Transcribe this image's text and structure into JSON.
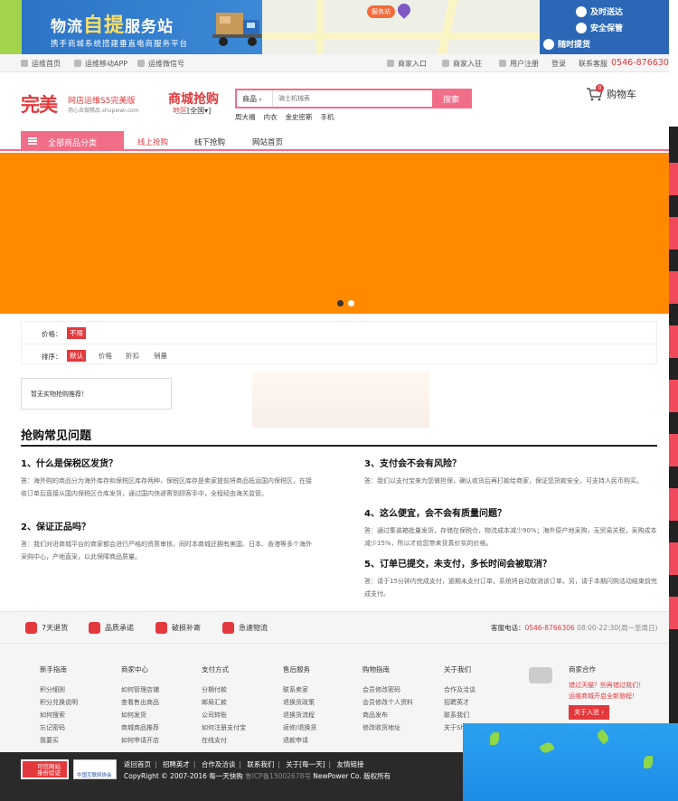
{
  "top_banner": {
    "title_part1": "物流",
    "title_big": "自提",
    "title_part2": "服务站",
    "subtitle": "携手商城系统搭建垂直电商服务平台",
    "map_pin_label": "服务站",
    "features": [
      "及时送达",
      "安全保管",
      "随时提货"
    ]
  },
  "site_nav": {
    "links": [
      "运维首页",
      "运维移动APP",
      "运维微信号",
      "商家入口",
      "商家入驻",
      "用户注册",
      "登录",
      "联系客服"
    ],
    "phone": "0546-8766306"
  },
  "header": {
    "logo": "完美",
    "logo_sub1": "网店运维S5完美版",
    "logo_sub2": "用心去做精品 shopwwi.com",
    "mall_title": "商城抢购",
    "region_label": "地区",
    "region_value": "[全国▾]",
    "search_category": "商品",
    "search_placeholder": "骑士机械表",
    "search_button": "搜索",
    "hot_words": [
      "周大福",
      "内衣",
      "金史密斯",
      "手机"
    ],
    "cart_label": "购物车",
    "cart_count": "0"
  },
  "main_nav": {
    "all_categories": "全部商品分类",
    "links": [
      "线上抢购",
      "线下抢购",
      "网站首页"
    ]
  },
  "filter": {
    "price_label": "价格：",
    "price_options": [
      "不限"
    ],
    "sort_label": "排序：",
    "sort_options": [
      "默认",
      "价格",
      "折扣",
      "销量"
    ]
  },
  "empty_message": "暂无实物抢购推荐！",
  "faq": {
    "title": "抢购常见问题",
    "items": [
      {
        "q": "1、什么是保税区发货？",
        "a": "答：海外购的商品分为海外库存和保税区库存两种，保税区库存是卖家提前将商品抵运国内保税区，在接收订单后直接从国内保税区仓库发货，通过国内快递寄到顾客手中，全程经由海关监管。"
      },
      {
        "q": "2、保证正品吗？",
        "a": "答：我们对进商城平台的商家都会进行严格的资质审核，同时本商城还拥有美国、日本、香港等多个海外采购中心，产地直采，以此保障商品质量。"
      },
      {
        "q": "3、支付会不会有风险？",
        "a": "答：我们以支付宝来为您做担保，确认收货后再打款给商家，保证您货款安全，可支持人民币购买。"
      },
      {
        "q": "4、这么便宜，会不会有质量问题？",
        "a": "答：通过集装箱批量发货，存储在保税仓，物流成本减少90%；海外原产地采购，无贸易关税，采购成本减少15%，所以才给您带来货真价实的价格。"
      },
      {
        "q": "5、订单已提交，未支付，多长时间会被取消？",
        "a": "答：请于15分钟内完成支付，逾期未支付订单，系统将自动取消该订单。另，请于本期闪购活动结束前完成支付。"
      }
    ]
  },
  "service": {
    "items": [
      "7天退货",
      "品质承诺",
      "破损补寄",
      "急速物流"
    ],
    "phone_label": "客服电话：",
    "phone": "0546-8766306",
    "hours": "08:00-22:30(周一至周日)"
  },
  "footer": {
    "columns": [
      {
        "title": "新手指南",
        "links": [
          "积分细则",
          "积分兑换说明",
          "如何搜索",
          "忘记密码",
          "我要买"
        ]
      },
      {
        "title": "商家中心",
        "links": [
          "如何管理店铺",
          "查看售出商品",
          "如何发货",
          "商城商品推荐",
          "如何申请开店"
        ]
      },
      {
        "title": "支付方式",
        "links": [
          "分期付款",
          "邮局汇款",
          "公司转账",
          "如何注册支付宝",
          "在线支付"
        ]
      },
      {
        "title": "售后服务",
        "links": [
          "联系卖家",
          "退换货政策",
          "退换货流程",
          "返修/退换货",
          "退款申请"
        ]
      },
      {
        "title": "购物指南",
        "links": [
          "会员修改密码",
          "会员修改个人资料",
          "商品发布",
          "修改收货地址"
        ]
      },
      {
        "title": "关于我们",
        "links": [
          "合作及洽谈",
          "招聘英才",
          "联系我们",
          "关于Shop"
        ]
      }
    ],
    "merchant": {
      "title": "商家合作",
      "text1": "错过天猫？别再错过我们！",
      "text2": "运维商城开启全新旅程！",
      "button": "关于入驻 ›"
    }
  },
  "bottom": {
    "cert1": "可信网站 身份验证",
    "cert2": "中国互联网协会",
    "links": [
      "返回首页",
      "招聘英才",
      "合作及洽谈",
      "联系我们",
      "关于[每一天]",
      "友情链接"
    ],
    "copyright": "CopyRight © 2007-2016 每一天快购",
    "icp": "鲁ICP备15002678号",
    "power": "NewPower Co. 版权所有"
  }
}
